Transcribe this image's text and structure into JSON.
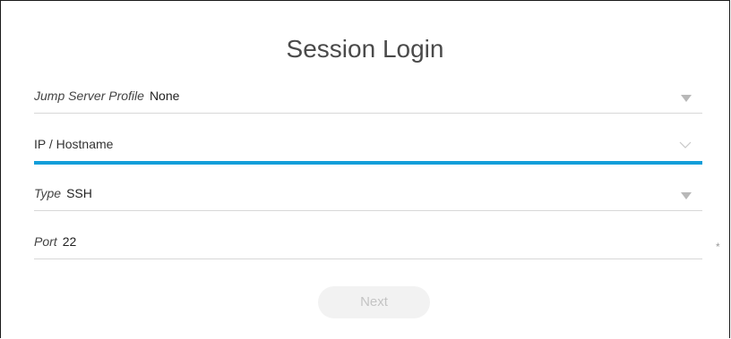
{
  "title": "Session Login",
  "fields": {
    "jump_server": {
      "label": "Jump Server Profile",
      "value": "None",
      "icon": "caret-down-icon"
    },
    "host": {
      "placeholder": "IP / Hostname",
      "value": "",
      "icon": "chevron-down-icon"
    },
    "type": {
      "label": "Type",
      "value": "SSH",
      "icon": "caret-down-icon"
    },
    "port": {
      "label": "Port",
      "value": "22",
      "required_marker": "*"
    }
  },
  "actions": {
    "next_label": "Next"
  },
  "colors": {
    "accent": "#119ed9",
    "divider": "#d8d8d8",
    "disabled_button_bg": "#f2f2f2",
    "disabled_button_text": "#c4c4c4"
  }
}
